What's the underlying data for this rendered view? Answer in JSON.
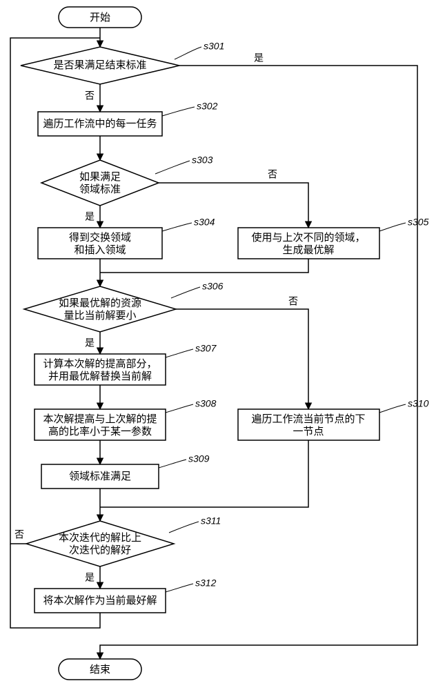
{
  "terminals": {
    "start": "开始",
    "end": "结束"
  },
  "nodes": {
    "s301": {
      "id": "s301",
      "text": "是否果满足结束标准",
      "type": "decision",
      "yes": "是",
      "no": "否"
    },
    "s302": {
      "id": "s302",
      "text": "遍历工作流中的每一任务",
      "type": "process"
    },
    "s303": {
      "id": "s303",
      "text_l1": "如果满足",
      "text_l2": "领域标准",
      "type": "decision",
      "yes": "是",
      "no": "否"
    },
    "s304": {
      "id": "s304",
      "text_l1": "得到交换领域",
      "text_l2": "和插入领域",
      "type": "process"
    },
    "s305": {
      "id": "s305",
      "text_l1": "使用与上次不同的领域，",
      "text_l2": "生成最优解",
      "type": "process"
    },
    "s306": {
      "id": "s306",
      "text_l1": "如果最优解的资源",
      "text_l2": "量比当前解要小",
      "type": "decision",
      "yes": "是",
      "no": "否"
    },
    "s307": {
      "id": "s307",
      "text_l1": "计算本次解的提高部分，",
      "text_l2": "并用最优解替换当前解",
      "type": "process"
    },
    "s308": {
      "id": "s308",
      "text_l1": "本次解提高与上次解的提",
      "text_l2": "高的比率小于某一参数",
      "type": "process"
    },
    "s309": {
      "id": "s309",
      "text": "领域标准满足",
      "type": "process"
    },
    "s310": {
      "id": "s310",
      "text_l1": "遍历工作流当前节点的下",
      "text_l2": "一节点",
      "type": "process"
    },
    "s311": {
      "id": "s311",
      "text_l1": "本次迭代的解比上",
      "text_l2": "次迭代的解好",
      "type": "decision",
      "yes": "是",
      "no": "否"
    },
    "s312": {
      "id": "s312",
      "text": "将本次解作为当前最好解",
      "type": "process"
    }
  },
  "chart_data": {
    "type": "flowchart",
    "title": "",
    "nodes": [
      {
        "id": "start",
        "type": "terminal",
        "label": "开始"
      },
      {
        "id": "s301",
        "type": "decision",
        "label": "是否果满足结束标准"
      },
      {
        "id": "s302",
        "type": "process",
        "label": "遍历工作流中的每一任务"
      },
      {
        "id": "s303",
        "type": "decision",
        "label": "如果满足领域标准"
      },
      {
        "id": "s304",
        "type": "process",
        "label": "得到交换领域和插入领域"
      },
      {
        "id": "s305",
        "type": "process",
        "label": "使用与上次不同的领域，生成最优解"
      },
      {
        "id": "s306",
        "type": "decision",
        "label": "如果最优解的资源量比当前解要小"
      },
      {
        "id": "s307",
        "type": "process",
        "label": "计算本次解的提高部分，并用最优解替换当前解"
      },
      {
        "id": "s308",
        "type": "process",
        "label": "本次解提高与上次解的提高的比率小于某一参数"
      },
      {
        "id": "s309",
        "type": "process",
        "label": "领域标准满足"
      },
      {
        "id": "s310",
        "type": "process",
        "label": "遍历工作流当前节点的下一节点"
      },
      {
        "id": "s311",
        "type": "decision",
        "label": "本次迭代的解比上次迭代的解好"
      },
      {
        "id": "s312",
        "type": "process",
        "label": "将本次解作为当前最好解"
      },
      {
        "id": "end",
        "type": "terminal",
        "label": "结束"
      }
    ],
    "edges": [
      {
        "from": "start",
        "to": "s301"
      },
      {
        "from": "s301",
        "to": "s302",
        "label": "否"
      },
      {
        "from": "s301",
        "to": "end",
        "label": "是"
      },
      {
        "from": "s302",
        "to": "s303"
      },
      {
        "from": "s303",
        "to": "s304",
        "label": "是"
      },
      {
        "from": "s303",
        "to": "s305",
        "label": "否"
      },
      {
        "from": "s304",
        "to": "s306"
      },
      {
        "from": "s305",
        "to": "s306"
      },
      {
        "from": "s306",
        "to": "s307",
        "label": "是"
      },
      {
        "from": "s306",
        "to": "s310",
        "label": "否"
      },
      {
        "from": "s307",
        "to": "s308"
      },
      {
        "from": "s308",
        "to": "s309"
      },
      {
        "from": "s309",
        "to": "s311"
      },
      {
        "from": "s310",
        "to": "s311"
      },
      {
        "from": "s311",
        "to": "s312",
        "label": "是"
      },
      {
        "from": "s311",
        "to": "start_loop",
        "label": "否"
      },
      {
        "from": "s312",
        "to": "start_loop"
      }
    ]
  }
}
